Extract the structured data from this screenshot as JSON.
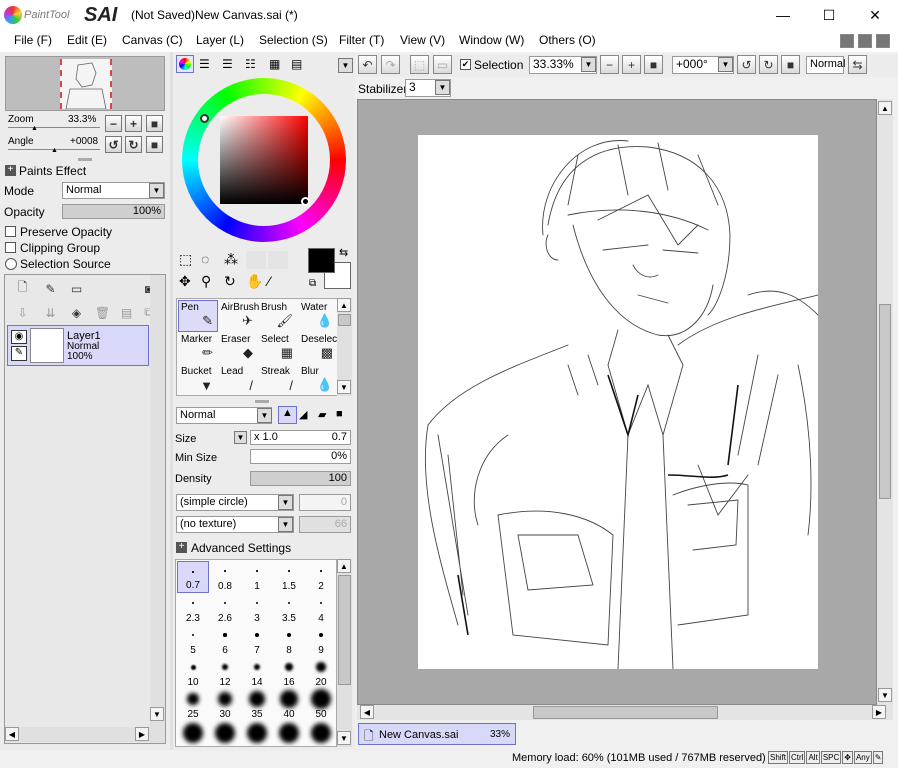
{
  "app": {
    "logo_brand": "PaintTool",
    "logo_name": "SAI",
    "title": "(Not Saved)New Canvas.sai (*)",
    "minimize": "—",
    "maximize": "☐",
    "close": "✕"
  },
  "menu": [
    "File (F)",
    "Edit (E)",
    "Canvas (C)",
    "Layer (L)",
    "Selection (S)",
    "Filter (T)",
    "View (V)",
    "Window (W)",
    "Others (O)"
  ],
  "navigator": {
    "zoom_label": "Zoom",
    "zoom_value": "33.3%",
    "angle_label": "Angle",
    "angle_value": "+0008"
  },
  "layer_props": {
    "paints_effect": "Paints Effect",
    "mode_label": "Mode",
    "mode_value": "Normal",
    "opacity_label": "Opacity",
    "opacity_value": "100%",
    "opacity_fraction": 1.0,
    "preserve_opacity": "Preserve Opacity",
    "clipping_group": "Clipping Group",
    "selection_source": "Selection Source"
  },
  "layers": [
    {
      "name": "Layer1",
      "mode": "Normal",
      "opacity": "100%"
    }
  ],
  "tools": [
    {
      "name": "Pen",
      "icon": "pen-icon",
      "glyph": "✎"
    },
    {
      "name": "AirBrush",
      "icon": "airbrush-icon",
      "glyph": "✈"
    },
    {
      "name": "Brush",
      "icon": "brush-icon",
      "glyph": "🖌"
    },
    {
      "name": "Water",
      "icon": "water-icon",
      "glyph": "💧"
    },
    {
      "name": "Marker",
      "icon": "marker-icon",
      "glyph": "✏"
    },
    {
      "name": "Eraser",
      "icon": "eraser-icon",
      "glyph": "◆"
    },
    {
      "name": "Select",
      "icon": "select-icon",
      "glyph": "▦"
    },
    {
      "name": "Deselect",
      "icon": "deselect-icon",
      "glyph": "▩"
    },
    {
      "name": "Bucket",
      "icon": "bucket-icon",
      "glyph": "▼"
    },
    {
      "name": "Lead",
      "icon": "lead-icon",
      "glyph": "/"
    },
    {
      "name": "Streak",
      "icon": "streak-icon",
      "glyph": "/"
    },
    {
      "name": "Blur",
      "icon": "blur-icon",
      "glyph": "💧"
    }
  ],
  "brush": {
    "mode_value": "Normal",
    "size_label": "Size",
    "size_multiplier": "x 1.0",
    "size_value": "0.7",
    "min_size_label": "Min Size",
    "min_size_value": "0%",
    "min_size_fraction": 0.0,
    "density_label": "Density",
    "density_value": "100",
    "density_fraction": 1.0,
    "shape_value": "(simple circle)",
    "shape_amount": "0",
    "texture_value": "(no texture)",
    "texture_amount": "66",
    "advanced": "Advanced Settings"
  },
  "brush_sizes": [
    "0.7",
    "0.8",
    "1",
    "1.5",
    "2",
    "2.3",
    "2.6",
    "3",
    "3.5",
    "4",
    "5",
    "6",
    "7",
    "8",
    "9",
    "10",
    "12",
    "14",
    "16",
    "20",
    "25",
    "30",
    "35",
    "40",
    "50"
  ],
  "canvas_toolbar": {
    "selection_label": "Selection",
    "zoom_value": "33.33%",
    "rotation_value": "+000°",
    "blend_value": "Normal",
    "stabilizer_label": "Stabilizer",
    "stabilizer_value": "3"
  },
  "tab": {
    "name": "New Canvas.sai",
    "zoom": "33%"
  },
  "status": {
    "memory": "Memory load: 60% (101MB used / 767MB reserved)",
    "keys": [
      "Shift",
      "Ctrl",
      "Alt",
      "SPC",
      "✥",
      "Any",
      "✎"
    ]
  },
  "colors": {
    "accent": "#7070d0",
    "selected_layer": "#d8d8f8",
    "canvas_bg": "#a8a8a8",
    "primary_color": "#000000",
    "secondary_color": "#ffffff"
  }
}
